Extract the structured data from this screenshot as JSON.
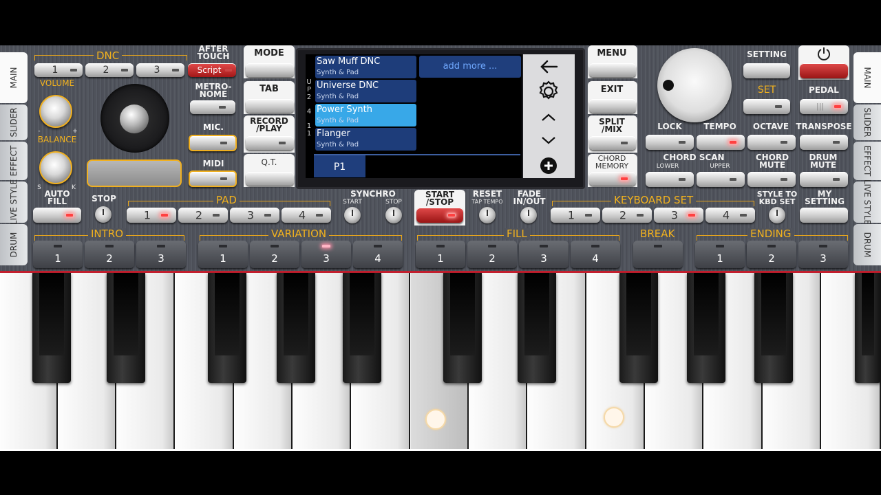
{
  "side_tabs_left": [
    "MAIN",
    "SLIDER",
    "EFFECT",
    "LIVE STYLE",
    "DRUM"
  ],
  "side_tabs_right": [
    "MAIN",
    "SLIDER",
    "EFFECT",
    "LIVE STYLE",
    "DRUM"
  ],
  "dnc": {
    "title": "DNC",
    "buttons": [
      "1",
      "2",
      "3",
      "Script"
    ]
  },
  "after_touch": "AFTER TOUCH",
  "metronome": "METRO- NOME",
  "mic": "MIC.",
  "midi": "MIDI",
  "volume": "VOLUME",
  "balance": "BALANCE",
  "balance_s": "S",
  "balance_k": "K",
  "volume_minus": "-",
  "volume_plus": "+",
  "mid_buttons": {
    "mode": "MODE",
    "tab": "TAB",
    "record": "RECORD /PLAY",
    "qt": "Q.T."
  },
  "right_buttons": {
    "menu": "MENU",
    "exit": "EXIT",
    "split": "SPLIT /MIX",
    "chord_memory": "CHORD MEMORY"
  },
  "display": {
    "sounds": [
      {
        "name": "Saw Muff DNC",
        "category": "Synth & Pad",
        "selected": false
      },
      {
        "name": "Universe DNC",
        "category": "Synth & Pad",
        "selected": false
      },
      {
        "name": "Power Synth",
        "category": "Synth & Pad",
        "selected": true
      },
      {
        "name": "Flanger",
        "category": "Synth & Pad",
        "selected": false
      }
    ],
    "add_more": "add more ...",
    "part_labels": [
      "U",
      "P",
      "2",
      "4",
      "1",
      "1"
    ],
    "page": "P1",
    "icons": [
      "back-arrow-icon",
      "gear-icon",
      "chevron-up-icon",
      "chevron-down-icon",
      "plus-circle-icon"
    ]
  },
  "top_right": {
    "setting": "SETTING",
    "set": "SET",
    "pedal": "PEDAL",
    "power_icon": "power-icon"
  },
  "row3": {
    "lock": "LOCK",
    "tempo": "TEMPO",
    "octave": "OCTAVE",
    "transpose": "TRANSPOSE"
  },
  "row4": {
    "chord_scan": "CHORD SCAN",
    "lower": "LOWER",
    "upper": "UPPER",
    "chord_mute": "CHORD MUTE",
    "drum_mute": "DRUM MUTE"
  },
  "style_row": {
    "auto_fill": "AUTO FILL",
    "stop": "STOP",
    "pad": "PAD",
    "pad_buttons": [
      "1",
      "2",
      "3",
      "4"
    ],
    "synchro": "SYNCHRO",
    "synchro_start": "START",
    "synchro_stop": "STOP",
    "start_stop": "START /STOP",
    "reset": "RESET",
    "tap_tempo": "TAP TEMPO",
    "fade": "FADE IN/OUT",
    "keyboard_set": "KEYBOARD SET",
    "kbd_buttons": [
      "1",
      "2",
      "3",
      "4"
    ],
    "style_to_kbd": "STYLE TO KBD SET",
    "my_setting": "MY SETTING"
  },
  "sections": {
    "intro": {
      "title": "INTRO",
      "buttons": [
        "1",
        "2",
        "3"
      ]
    },
    "variation": {
      "title": "VARIATION",
      "buttons": [
        "1",
        "2",
        "3",
        "4"
      ],
      "active": 3
    },
    "fill": {
      "title": "FILL",
      "buttons": [
        "1",
        "2",
        "3",
        "4"
      ]
    },
    "break": {
      "title": "BREAK"
    },
    "ending": {
      "title": "ENDING",
      "buttons": [
        "1",
        "2",
        "3"
      ]
    }
  }
}
